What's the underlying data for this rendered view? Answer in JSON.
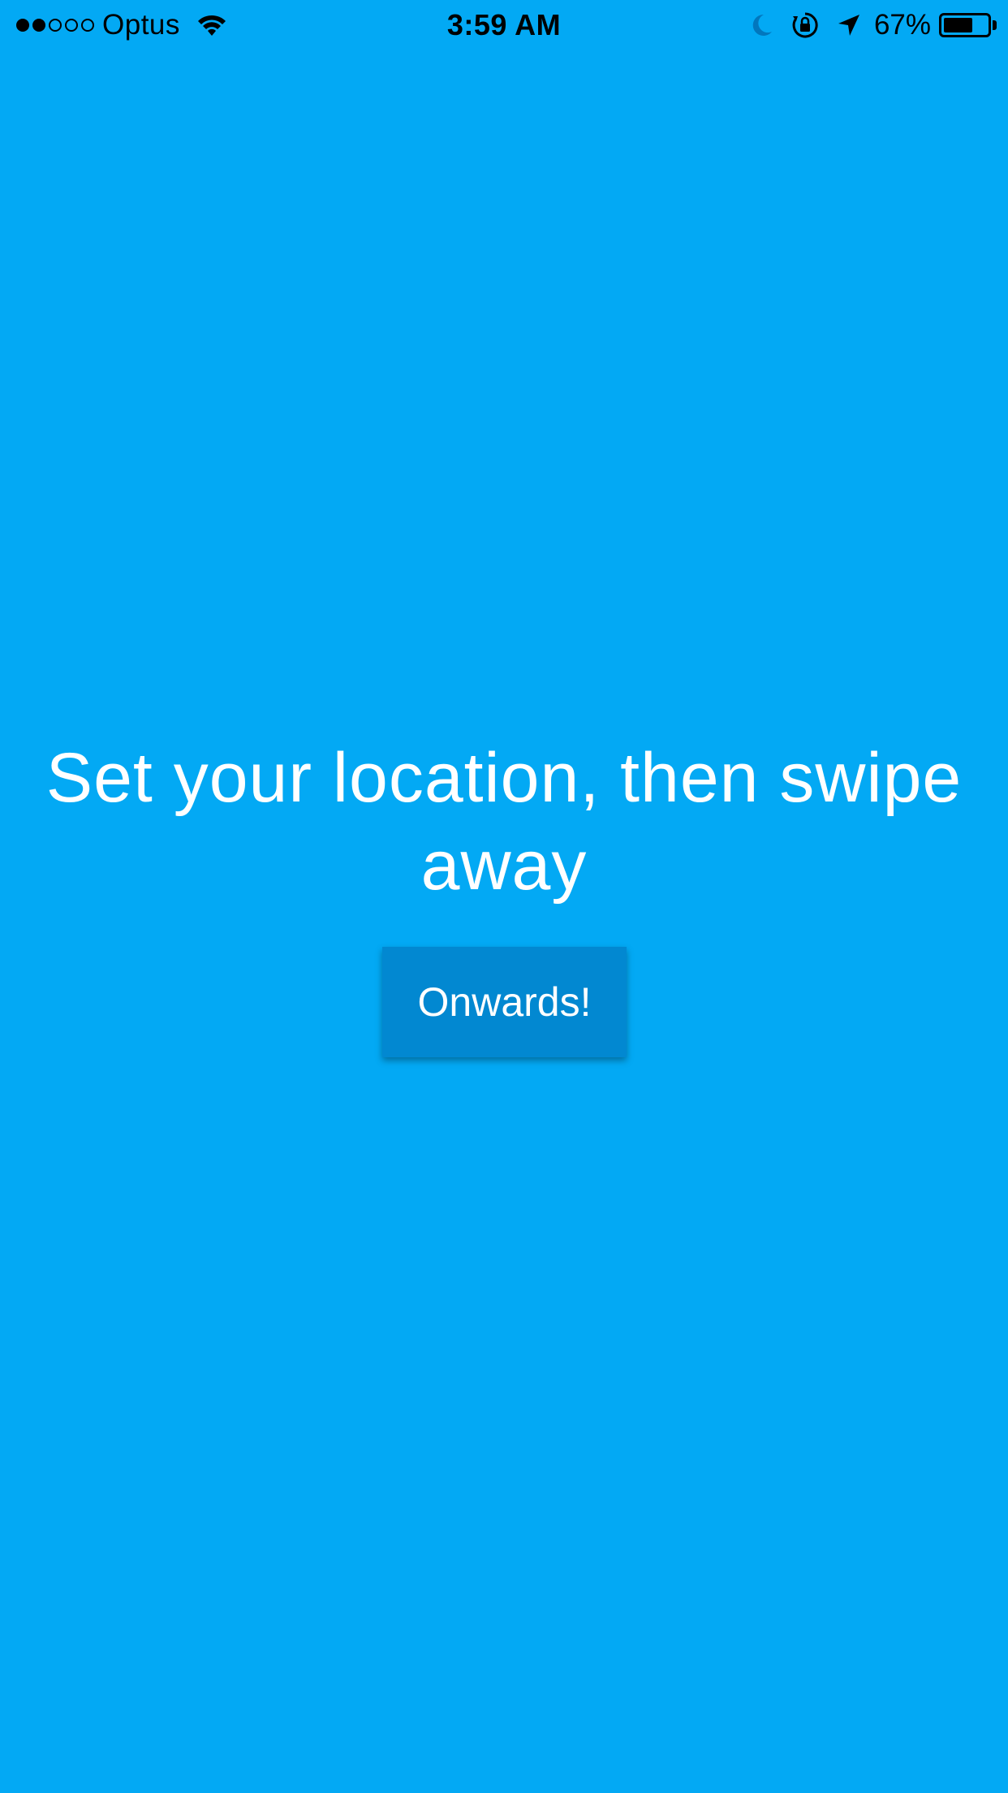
{
  "status_bar": {
    "carrier": "Optus",
    "signal_strength": 2,
    "signal_max": 5,
    "time": "3:59 AM",
    "battery_percent": "67%",
    "battery_level": 0.67,
    "icons": [
      "wifi-icon",
      "moon-icon",
      "rotation-lock-icon",
      "location-arrow-icon",
      "battery-icon"
    ]
  },
  "main": {
    "prompt": "Set your location, then swipe away",
    "button_label": "Onwards!"
  },
  "colors": {
    "background": "#03A9F4",
    "button": "#0288D1",
    "text": "#FFFFFF"
  }
}
